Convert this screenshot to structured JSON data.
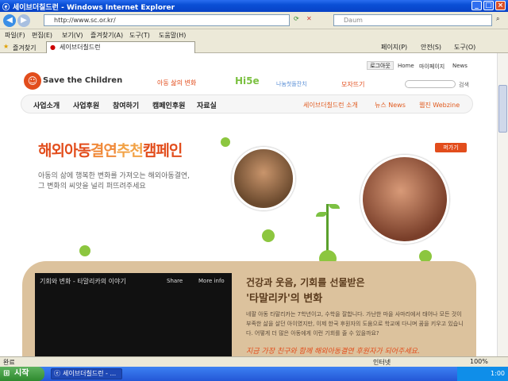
{
  "window": {
    "title": "세이브더칠드런 - Windows Internet Explorer"
  },
  "address": {
    "url": "http://www.sc.or.kr/",
    "search_placeholder": "Daum"
  },
  "menu": [
    "파일(F)",
    "편집(E)",
    "보기(V)",
    "즐겨찾기(A)",
    "도구(T)",
    "도움말(H)"
  ],
  "favorites": {
    "label": "즐겨찾기",
    "tab": "세이브더칠드런"
  },
  "toolbar": {
    "page": "페이지(P)",
    "safety": "안전(S)",
    "tools": "도구(O)"
  },
  "site": {
    "logo": "Save the Children",
    "top_links": [
      "로그아웃",
      "Home",
      "마이페이지",
      "News"
    ],
    "campaign_links": [
      "아동 삶의 변화",
      "Hi5e",
      "나눔첫돌잔치",
      "모자뜨기"
    ],
    "search_label": "검색",
    "nav": [
      "사업소개",
      "사업후원",
      "참여하기",
      "캠페인후원",
      "자료실"
    ],
    "sub_nav": [
      "세이브더칠드런 소개",
      "뉴스 News",
      "웹진 Webzine"
    ],
    "hero": {
      "title_part1": "해외아동",
      "title_part2": "결연",
      "title_part3": "추천",
      "title_part4": "캠페인",
      "sub1": "아동의 삶에 행복한 변화를 가져오는 해외아동결연,",
      "sub2": "그 변화의 씨앗을 널리 퍼뜨려주세요",
      "badge": "퍼가기"
    },
    "video": {
      "title": "기회와 변화 - 타말리카의 이야기",
      "share": "Share",
      "more": "More info"
    },
    "story": {
      "heading1": "건강과 웃음, 기회를 선물받은",
      "heading2": "'타말리카'의 변화",
      "body": "네팔 아동 타말리카는 7학년이고, 수학을 잘합니다. 가난한 마을 사마리에서 태어나 모든 것이 부족한 삶을 살던 아이였지만, 이제 한국 후원자의 도움으로 학교에 다니며 꿈을 키우고 있습니다. 어떻게 더 많은 아동에게 이런 기회를 줄 수 있을까요?",
      "handwriting": "지금 가장 친구와 함께 해외아동결연 후원자가 되어주세요."
    }
  },
  "status": {
    "left": "완료",
    "zone": "인터넷",
    "zoom": "100%"
  },
  "taskbar": {
    "start": "시작",
    "item": "세이브더칠드런 - ...",
    "time": "1:00"
  },
  "colors": {
    "accent": "#e24d1c",
    "green": "#7cc142",
    "brown": "#d9b98f"
  }
}
